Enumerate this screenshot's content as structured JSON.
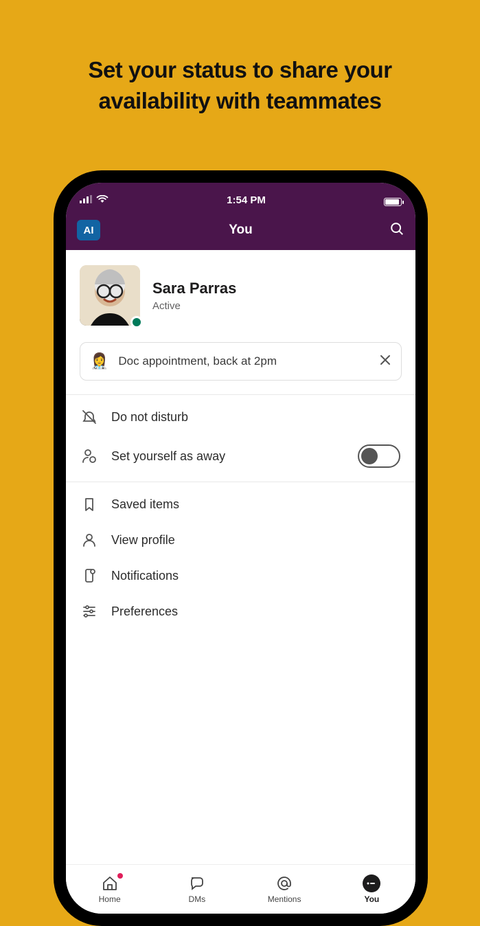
{
  "promo": {
    "title": "Set your status to share your availability with teammates"
  },
  "statusbar": {
    "time": "1:54 PM"
  },
  "nav": {
    "ai_label": "AI",
    "title": "You"
  },
  "profile": {
    "name": "Sara Parras",
    "presence": "Active"
  },
  "status_input": {
    "emoji": "👩‍⚕️",
    "text": "Doc appointment, back at 2pm"
  },
  "menu": {
    "section1": [
      {
        "id": "dnd",
        "label": "Do not disturb"
      },
      {
        "id": "away",
        "label": "Set yourself as away",
        "toggle": false
      }
    ],
    "section2": [
      {
        "id": "saved",
        "label": "Saved items"
      },
      {
        "id": "profile",
        "label": "View profile"
      },
      {
        "id": "notifications",
        "label": "Notifications"
      },
      {
        "id": "preferences",
        "label": "Preferences"
      }
    ]
  },
  "tabs": [
    {
      "id": "home",
      "label": "Home",
      "badge": true
    },
    {
      "id": "dms",
      "label": "DMs"
    },
    {
      "id": "mentions",
      "label": "Mentions"
    },
    {
      "id": "you",
      "label": "You",
      "active": true
    }
  ]
}
